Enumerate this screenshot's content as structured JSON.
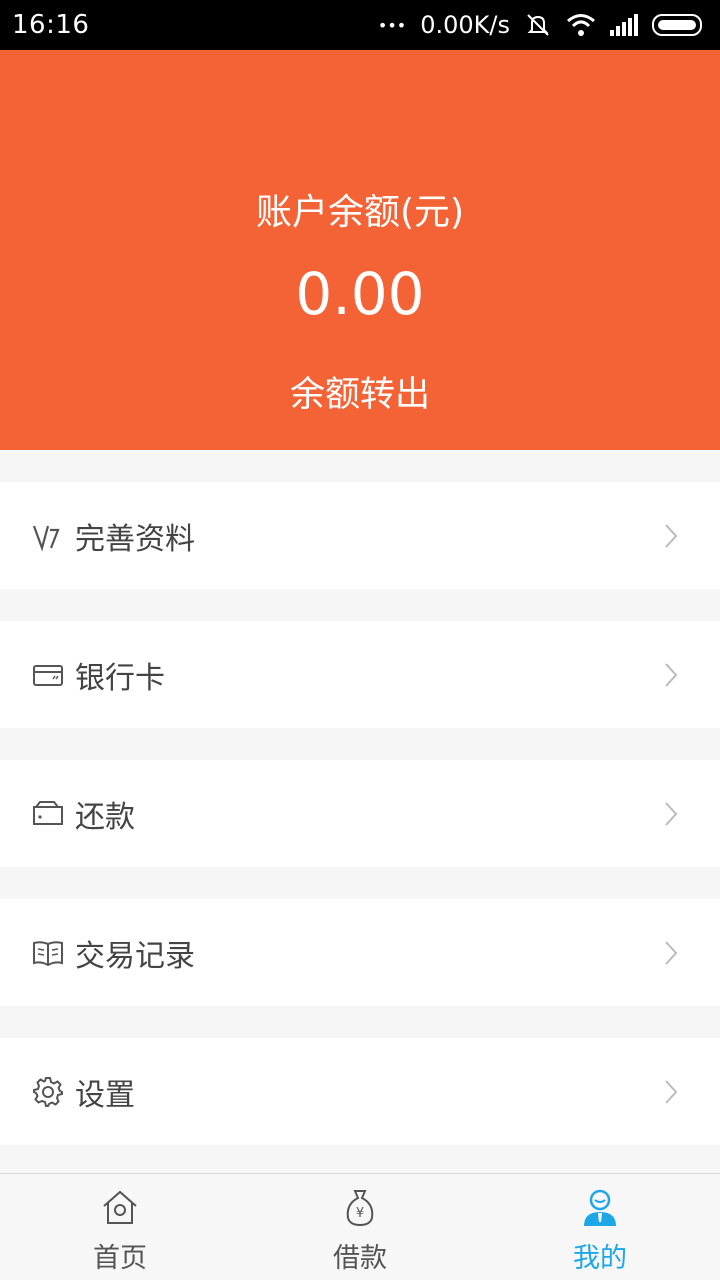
{
  "status_bar": {
    "time": "16:16",
    "dots": "•••",
    "speed": "0.00K/s"
  },
  "header": {
    "balance_label": "账户余额(元)",
    "balance_value": "0.00",
    "transfer_label": "余额转出"
  },
  "menu": {
    "items": [
      {
        "label": "完善资料",
        "icon": "verify-icon"
      },
      {
        "label": "银行卡",
        "icon": "bank-card-icon"
      },
      {
        "label": "还款",
        "icon": "wallet-icon"
      },
      {
        "label": "交易记录",
        "icon": "book-icon"
      },
      {
        "label": "设置",
        "icon": "gear-icon"
      }
    ]
  },
  "tabbar": {
    "tabs": [
      {
        "label": "首页",
        "icon": "home-icon"
      },
      {
        "label": "借款",
        "icon": "money-bag-icon"
      },
      {
        "label": "我的",
        "icon": "user-icon"
      }
    ],
    "active_index": 2
  },
  "colors": {
    "accent": "#f36336",
    "active_tab": "#1ea7e7",
    "background": "#f6f6f6"
  }
}
